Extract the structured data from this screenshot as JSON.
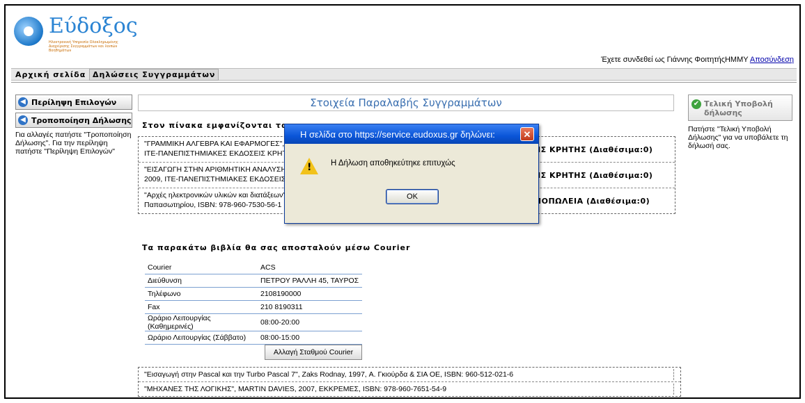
{
  "header": {
    "logo_text": "Εύδοξος",
    "logo_sub": "Ηλεκτρονική Υπηρεσία Ολοκληρωμένης Διαχείρισης Συγγραμμάτων και λοιπών Βοηθημάτων",
    "user_text": "Έχετε συνδεθεί ως Γιάννης ΦοιτητήςΗΜΜΥ",
    "logout_label": "Αποσύνδεση"
  },
  "nav": {
    "tabs": [
      {
        "label": "Αρχική σελίδα"
      },
      {
        "label": "Δηλώσεις Συγγραμμάτων"
      }
    ]
  },
  "left": {
    "btn_summary": "Περίληψη Επιλογών",
    "btn_modify": "Τροποποίηση Δήλωσης",
    "help": "Για αλλαγές πατήστε \"Τροποποίηση Δήλωσης\". Για την περίληψη πατήστε \"Περίληψη Επιλογών\""
  },
  "center": {
    "title": "Στοιχεία Παραλαβής Συγγραμμάτων",
    "info": "Στον πίνακα εμφανίζονται τα σημ",
    "books": [
      {
        "line1": "\"ΓΡΑΜΜΙΚΗ ΑΛΓΕΒΡΑ ΚΑΙ ΕΦΑΡΜΟΓΕΣ\",",
        "line2": "ΙΤΕ-ΠΑΝΕΠΙΣΤΗΜΙΑΚΕΣ ΕΚΔΟΣΕΙΣ ΚΡΗΤΗ",
        "avail": "ΕΙΣ ΚΡΗΤΗΣ (Διαθέσιμα:0)"
      },
      {
        "line1": "\"ΕΙΣΑΓΩΓΗ ΣΤΗΝ ΑΡΙΘΜΗΤΙΚΗ ΑΝΑΛΥΣΗ\"",
        "line2": "2009, ΙΤΕ-ΠΑΝΕΠΙΣΤΗΜΙΑΚΕΣ ΕΚΔΟΣΕΙΣ Κ",
        "avail": "ΕΙΣ ΚΡΗΤΗΣ (Διαθέσιμα:0)"
      },
      {
        "line1": "\"Αρχές ηλεκτρονικών υλικών και διατάξεων\"",
        "line2": "Παπασωτηρίου, ISBN: 978-960-7530-56-1",
        "avail": "ΛΙΟΠΩΛΕΙΑ (Διαθέσιμα:0)"
      }
    ],
    "courier_heading": "Τα παρακάτω βιβλία θα σας αποσταλούν μέσω Courier",
    "courier": [
      {
        "key": "Courier",
        "value": "ACS"
      },
      {
        "key": "Διεύθυνση",
        "value": "ΠΕΤΡΟΥ ΡΑΛΛΗ 45, ΤΑΥΡΟΣ"
      },
      {
        "key": "Τηλέφωνο",
        "value": "2108190000"
      },
      {
        "key": "Fax",
        "value": "210 8190311"
      },
      {
        "key": "Ωράριο Λειτουργίας (Καθημερινές)",
        "value": "08:00-20:00"
      },
      {
        "key": "Ωράριο Λειτουργίας (Σάββατο)",
        "value": "08:00-15:00"
      }
    ],
    "change_courier_label": "Αλλαγή Σταθμού Courier",
    "courier_books": [
      "\"Εισαγωγή στην Pascal και την Turbo Pascal 7\", Zaks Rodnay, 1997, Α. Γκιούρδα & ΣΙΑ ΟΕ, ISBN: 960-512-021-6",
      "\"ΜΗΧΑΝΕΣ ΤΗΣ ΛΟΓΙΚΗΣ\", MARTIN DAVIES, 2007, ΕΚΚΡΕΜΕΣ, ISBN: 978-960-7651-54-9"
    ]
  },
  "right": {
    "submit_label": "Τελική Υποβολή δήλωσης",
    "help": "Πατήστε \"Τελική Υποβολή Δήλωσης\" για να υποβάλετε τη δήλωσή σας."
  },
  "dialog": {
    "title": "Η σελίδα στο https://service.eudoxus.gr δηλώνει:",
    "message": "Η Δήλωση αποθηκεύτηκε επιτυχώς",
    "ok_label": "OK",
    "close_glyph": "✕"
  }
}
